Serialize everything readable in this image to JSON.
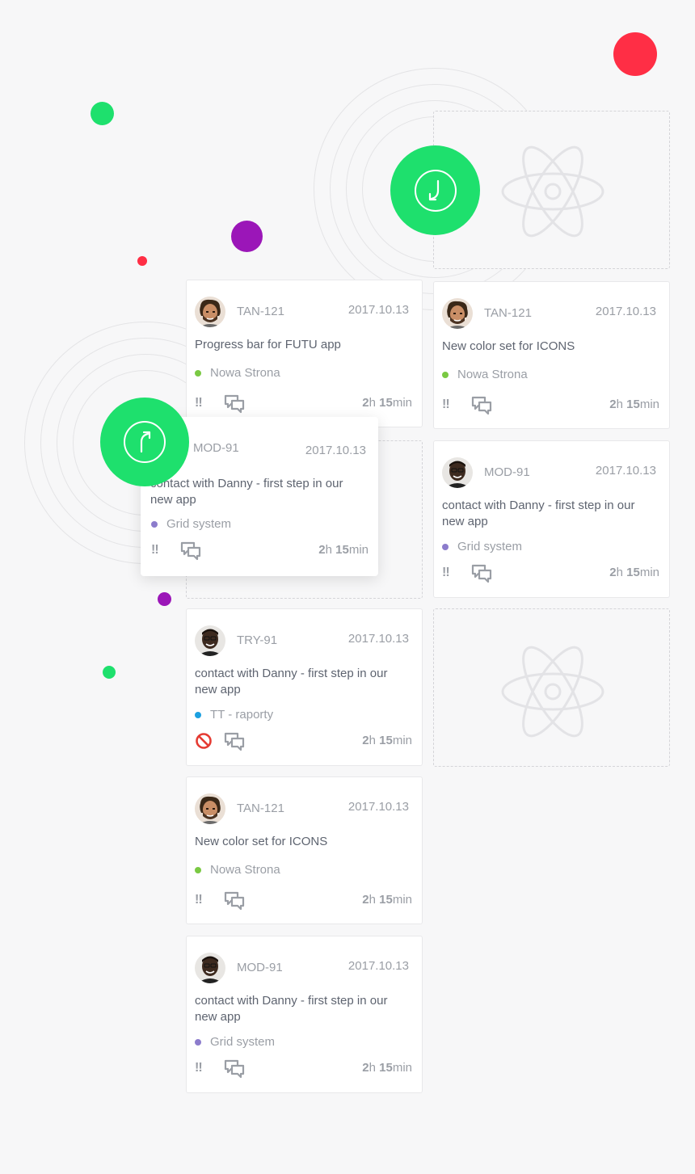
{
  "colors": {
    "accent_green": "#1ee06d",
    "dot_red": "#ff2e45",
    "dot_purple": "#9b16b8",
    "project_green": "#7ac943",
    "project_purple": "#8c7ccc",
    "project_blue": "#1ca0e0",
    "block_red": "#e53b33"
  },
  "actions": {
    "incoming_icon": "arrow-down-left-icon",
    "outgoing_icon": "arrow-up-right-icon"
  },
  "placeholder": {
    "icon": "react-atom-icon"
  },
  "cards": {
    "c1": {
      "code": "TAN-121",
      "date": "2017.10.13",
      "title": "Progress bar for FUTU app",
      "project": "Nowa Strona",
      "priority": "!!",
      "time_h": "2",
      "time_h_unit": "h",
      "time_m": "15",
      "time_m_unit": "min"
    },
    "c2": {
      "code": "TAN-121",
      "date": "2017.10.13",
      "title": "New color set for ICONS",
      "project": "Nowa Strona",
      "priority": "!!",
      "time_h": "2",
      "time_h_unit": "h",
      "time_m": "15",
      "time_m_unit": "min"
    },
    "c3": {
      "code": "MOD-91",
      "date": "2017.10.13",
      "title": "contact with Danny - first step in our new app",
      "project": "Grid system",
      "priority": "!!",
      "time_h": "2",
      "time_h_unit": "h",
      "time_m": "15",
      "time_m_unit": "min"
    },
    "c4": {
      "code": "MOD-91",
      "date": "2017.10.13",
      "title": "contact with Danny - first step in our new app",
      "project": "Grid system",
      "priority": "!!",
      "time_h": "2",
      "time_h_unit": "h",
      "time_m": "15",
      "time_m_unit": "min"
    },
    "c5": {
      "code": "TRY-91",
      "date": "2017.10.13",
      "title": "contact with Danny - first step in our new app",
      "project": "TT - raporty",
      "time_h": "2",
      "time_h_unit": "h",
      "time_m": "15",
      "time_m_unit": "min"
    },
    "c6": {
      "code": "TAN-121",
      "date": "2017.10.13",
      "title": "New color set for ICONS",
      "project": "Nowa Strona",
      "priority": "!!",
      "time_h": "2",
      "time_h_unit": "h",
      "time_m": "15",
      "time_m_unit": "min"
    },
    "c7": {
      "code": "MOD-91",
      "date": "2017.10.13",
      "title": "contact with Danny - first step in our new app",
      "project": "Grid system",
      "priority": "!!",
      "time_h": "2",
      "time_h_unit": "h",
      "time_m": "15",
      "time_m_unit": "min"
    }
  }
}
